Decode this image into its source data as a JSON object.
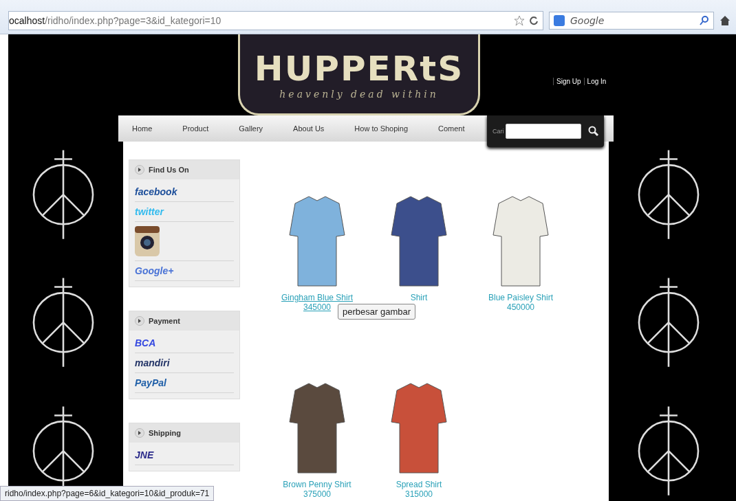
{
  "browser": {
    "url_host": "ocalhost",
    "url_path": "/ridho/index.php?page=3&id_kategori=10",
    "search_placeholder": "Google"
  },
  "header": {
    "logo_title": "HUPPERtS",
    "logo_tagline": "heavenly dead within",
    "account_links": [
      "Sign Up",
      "Log In"
    ]
  },
  "nav": {
    "items": [
      {
        "label": "Home"
      },
      {
        "label": "Product"
      },
      {
        "label": "Gallery"
      },
      {
        "label": "About Us"
      },
      {
        "label": "How to Shoping"
      },
      {
        "label": "Coment"
      }
    ],
    "search_label": "Cari"
  },
  "sidebar": [
    {
      "title": "Find Us On",
      "items": [
        {
          "kind": "text",
          "label": "facebook",
          "color": "#1c4e9a"
        },
        {
          "kind": "text",
          "label": "twitter",
          "color": "#33bbee"
        },
        {
          "kind": "camera"
        },
        {
          "kind": "text",
          "label": "Google+",
          "color": "#4a73d6"
        }
      ]
    },
    {
      "title": "Payment",
      "items": [
        {
          "kind": "text",
          "label": "BCA",
          "color": "#3347e0"
        },
        {
          "kind": "text",
          "label": "mandiri",
          "color": "#223366"
        },
        {
          "kind": "text",
          "label": "PayPal",
          "color": "#1f5fa8"
        }
      ]
    },
    {
      "title": "Shipping",
      "items": [
        {
          "kind": "text",
          "label": "JNE",
          "color": "#2a2a8a"
        }
      ]
    }
  ],
  "products": [
    {
      "name": "Gingham Blue Shirt",
      "price": "345000",
      "color": "#7fb2dc",
      "hovered": true
    },
    {
      "name": "Shirt",
      "color": "#3c4f8c",
      "hovered": false
    },
    {
      "name": "Blue Paisley Shirt",
      "price": "450000",
      "color": "#ecebe4",
      "hovered": false
    },
    {
      "name": "Brown Penny Shirt",
      "price": "375000",
      "color": "#5a4a3e",
      "hovered": false
    },
    {
      "name": "Spread Shirt",
      "price": "315000",
      "color": "#c8503a",
      "hovered": false
    }
  ],
  "tooltip": "perbesar gambar",
  "status_bar": "ridho/index.php?page=6&id_kategori=10&id_produk=71"
}
